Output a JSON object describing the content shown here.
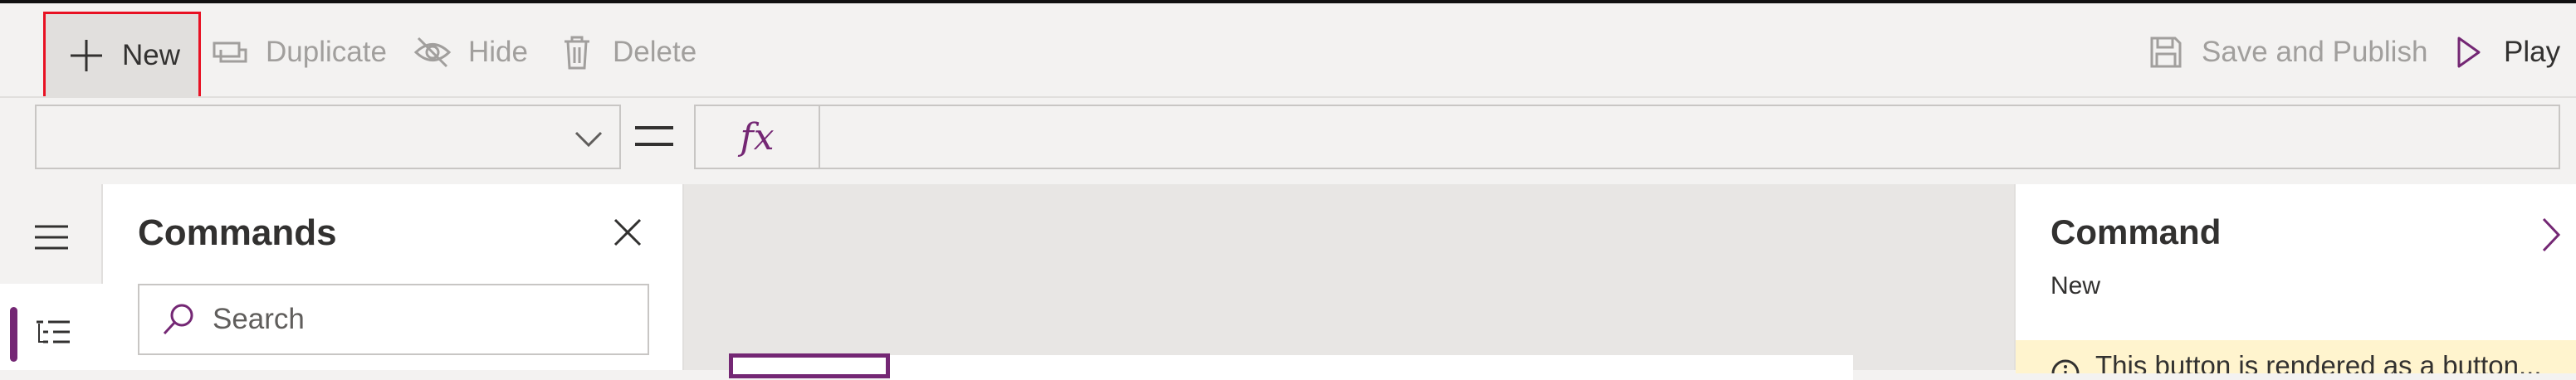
{
  "toolbar": {
    "new_label": "New",
    "duplicate_label": "Duplicate",
    "hide_label": "Hide",
    "delete_label": "Delete",
    "save_publish_label": "Save and Publish",
    "play_label": "Play"
  },
  "formula_bar": {
    "property_value": "",
    "fx_label": "fx",
    "formula_value": ""
  },
  "commands_panel": {
    "title": "Commands",
    "search_placeholder": "Search"
  },
  "properties_panel": {
    "title": "Command",
    "subtitle": "New",
    "warning_text": "This button is rendered as a button..."
  },
  "colors": {
    "accent": "#742774",
    "highlight_border": "#e81123",
    "warning_bg": "#fff4ce"
  },
  "icons": [
    "plus-icon",
    "duplicate-icon",
    "hide-icon",
    "delete-icon",
    "save-icon",
    "play-icon",
    "chevron-down-icon",
    "equals-icon",
    "hamburger-icon",
    "tree-view-icon",
    "close-icon",
    "search-icon",
    "chevron-right-icon",
    "info-icon"
  ]
}
